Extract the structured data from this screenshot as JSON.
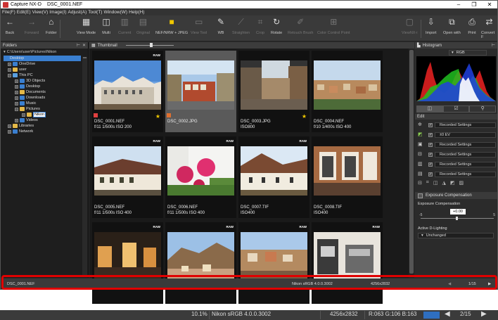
{
  "window": {
    "app_name": "Capture NX-D",
    "file_name": "DSC_0001.NEF"
  },
  "menu": [
    "File(F)",
    "Edit(E)",
    "View(V)",
    "Image(I)",
    "Adjust(A)",
    "Tool(T)",
    "Window(W)",
    "Help(H)"
  ],
  "toolbar": {
    "back": "Back",
    "forward": "Forward",
    "folder": "Folder",
    "view_mode": "View Mode",
    "multi": "Multi",
    "current": "Current",
    "original": "Original",
    "nef_jpeg": "NEF/NRW + JPEG",
    "view_tool": "View Tool",
    "wb": "WB",
    "straighten": "Straighten",
    "crop": "Crop",
    "rotate": "Rotate",
    "retouch": "Retouch Brush",
    "color_control": "Color Control Point",
    "viewnx": "ViewNX-i",
    "import": "Import",
    "open_with": "Open with",
    "print": "Print",
    "convert": "Convert F"
  },
  "folders": {
    "title": "Folders",
    "path": "C:\\Users\\user\\Pictures\\Nikon",
    "items": [
      "Desktop",
      "OneDrive",
      "user",
      "This PC",
      "3D Objects",
      "Desktop",
      "Documents",
      "Downloads",
      "Music",
      "Pictures",
      "Nikon",
      "Videos",
      "Libraries",
      "Network"
    ]
  },
  "thumbnail": {
    "title": "Thumbnail",
    "raw_badge": "RAW",
    "star": "★",
    "items": [
      {
        "name": "DSC_0001.NEF",
        "exif": "f/11 1/500s ISO 200"
      },
      {
        "name": "DSC_0002.JPG",
        "exif": ""
      },
      {
        "name": "DSC_0003.JPG",
        "exif": "ISO800"
      },
      {
        "name": "DSC_0004.NEF",
        "exif": "f/10 1/400s ISO 400"
      },
      {
        "name": "DSC_0005.NEF",
        "exif": "f/11 1/500s ISO 400"
      },
      {
        "name": "DSC_0006.NEF",
        "exif": "f/11 1/500s ISO 400"
      },
      {
        "name": "DSC_0007.TIF",
        "exif": "ISO400"
      },
      {
        "name": "DSC_0008.TIF",
        "exif": "ISO400"
      },
      {
        "name": "",
        "exif": ""
      },
      {
        "name": "",
        "exif": ""
      },
      {
        "name": "",
        "exif": ""
      },
      {
        "name": "",
        "exif": ""
      }
    ]
  },
  "histogram": {
    "title": "Histogram",
    "channel": "RGB"
  },
  "edit": {
    "title": "Edit",
    "steps": [
      "Recorded Settings",
      "±0 EV",
      "Recorded Settings",
      "Recorded Settings",
      "Recorded Settings",
      "Recorded Settings"
    ]
  },
  "exposure": {
    "panel_title": "Exposure Compensation",
    "label": "Exposure Compensation",
    "value": "+0.00",
    "min": "-5",
    "max": "5",
    "adl_label": "Active D-Lighting",
    "adl_value": "Unchanged"
  },
  "statusbar": {
    "file": "DSC_0001.NEF",
    "profile": "Nikon sRGB 4.0.0.3002",
    "dimensions": "4256x2832",
    "page": "1/15"
  },
  "bottom_bar": {
    "zoom": "10.1%",
    "profile": "Nikon sRGB 4.0.0.3002",
    "dimensions": "4256x2832",
    "rgb": "R:063 G:106 B:163",
    "page": "2/15"
  }
}
